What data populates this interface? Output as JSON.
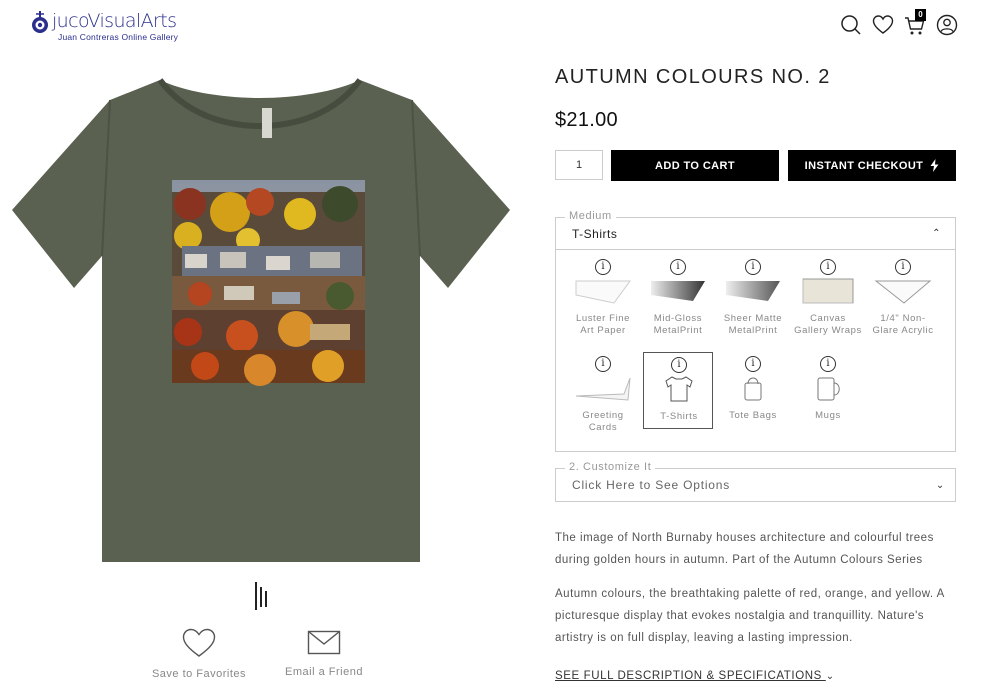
{
  "header": {
    "logo_name": "jucoVisualArts",
    "logo_subtitle": "Juan Contreras Online Gallery",
    "cart_count": "0",
    "icons": [
      "search-icon",
      "heart-icon",
      "cart-icon",
      "user-icon"
    ]
  },
  "product": {
    "title": "AUTUMN COLOURS NO. 2",
    "price": "$21.00",
    "quantity": "1",
    "add_to_cart_label": "ADD TO CART",
    "instant_checkout_label": "INSTANT CHECKOUT",
    "shirt_color": "#535a4a"
  },
  "medium": {
    "legend": "Medium",
    "selected": "T-Shirts",
    "options": [
      {
        "label": "Luster Fine Art Paper",
        "icon": "paper-icon",
        "selected": false
      },
      {
        "label": "Mid-Gloss MetalPrint",
        "icon": "metal-icon",
        "selected": false
      },
      {
        "label": "Sheer Matte MetalPrint",
        "icon": "metal-matte-icon",
        "selected": false
      },
      {
        "label": "Canvas Gallery Wraps",
        "icon": "canvas-icon",
        "selected": false
      },
      {
        "label": "1/4\" Non-Glare Acrylic",
        "icon": "acrylic-icon",
        "selected": false
      },
      {
        "label": "Greeting Cards",
        "icon": "greeting-card-icon",
        "selected": false
      },
      {
        "label": "T-Shirts",
        "icon": "tshirt-icon",
        "selected": true
      },
      {
        "label": "Tote Bags",
        "icon": "tote-bag-icon",
        "selected": false
      },
      {
        "label": "Mugs",
        "icon": "mug-icon",
        "selected": false
      }
    ]
  },
  "customize": {
    "legend": "2. Customize It",
    "placeholder": "Click Here to See Options"
  },
  "description": {
    "para1": "The image of North Burnaby houses architecture and colourful trees during golden hours in autumn. Part of the Autumn Colours Series",
    "para2": "Autumn colours, the breathtaking palette of red, orange, and yellow. A picturesque display that evokes nostalgia and tranquillity. Nature's artistry is on full display, leaving a lasting impression.",
    "see_full": "SEE FULL DESCRIPTION & SPECIFICATIONS"
  },
  "share": {
    "favorites_label": "Save to Favorites",
    "email_label": "Email a Friend"
  }
}
